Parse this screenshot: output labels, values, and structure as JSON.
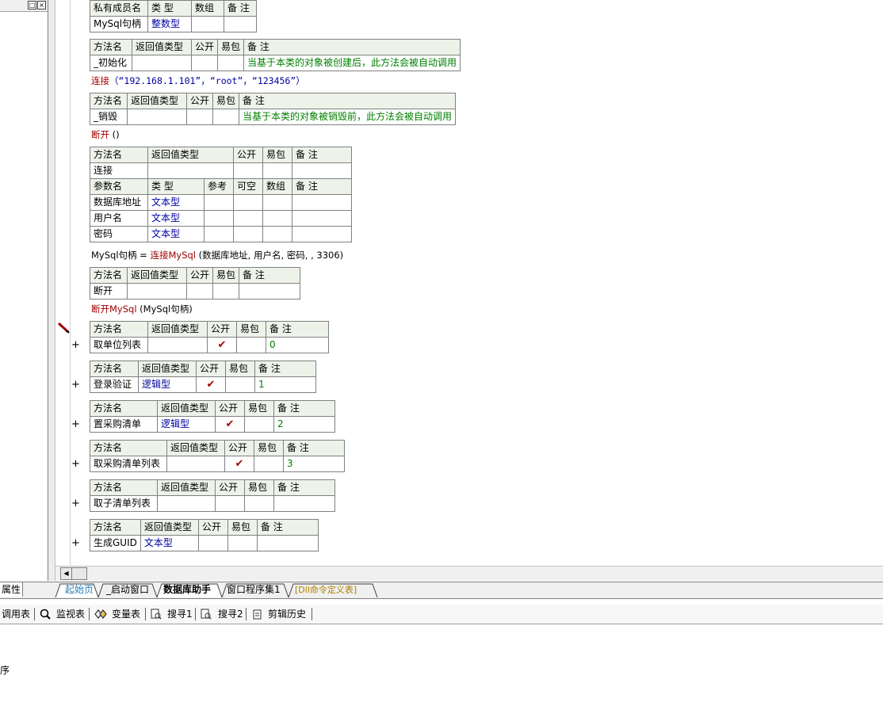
{
  "left_pane": {
    "props_tab": "属性",
    "controls": [
      "□",
      "×"
    ]
  },
  "member_table": {
    "headers": [
      "私有成员名",
      "类 型",
      "数组",
      "备 注"
    ],
    "row": {
      "name": "MySql句柄",
      "type": "整数型"
    }
  },
  "method_header": [
    "方法名",
    "返回值类型",
    "公开",
    "易包",
    "备 注"
  ],
  "param_header": [
    "参数名",
    "类 型",
    "参考",
    "可空",
    "数组",
    "备 注"
  ],
  "init_method": {
    "name": "_初始化",
    "note": "当基于本类的对象被创建后，此方法会被自动调用"
  },
  "init_code": {
    "fn": "连接",
    "args": "（“192.168.1.101”，“root”，“123456”）"
  },
  "destroy_method": {
    "name": "_销毁",
    "note": "当基于本类的对象被销毁前，此方法会被自动调用"
  },
  "destroy_code": {
    "fn": "断开",
    "args": " ()"
  },
  "connect_method": {
    "name": "连接",
    "params": [
      {
        "name": "数据库地址",
        "type": "文本型"
      },
      {
        "name": "用户名",
        "type": "文本型"
      },
      {
        "name": "密码",
        "type": "文本型"
      }
    ]
  },
  "connect_code": {
    "lhs": "MySql句柄",
    "eq": " = ",
    "fn": "连接MySql",
    "args": " (数据库地址, 用户名, 密码, , 3306)"
  },
  "disconnect_method": {
    "name": "断开"
  },
  "disconnect_code": {
    "fn": "断开MySql",
    "args": " (MySql句柄)"
  },
  "methods": [
    {
      "name": "取单位列表",
      "ret": "",
      "public": "✔",
      "note": "0"
    },
    {
      "name": "登录验证",
      "ret": "逻辑型",
      "public": "✔",
      "note": "1"
    },
    {
      "name": "置采购清单",
      "ret": "逻辑型",
      "public": "✔",
      "note": "2"
    },
    {
      "name": "取采购清单列表",
      "ret": "",
      "public": "✔",
      "note": "3"
    },
    {
      "name": "取子清单列表",
      "ret": "",
      "public": "",
      "note": ""
    },
    {
      "name": "生成GUID",
      "ret": "文本型",
      "public": "",
      "note": ""
    }
  ],
  "plus_symbol": "+",
  "tabs": [
    "起始页",
    "_启动窗口",
    "数据库助手",
    "窗口程序集1",
    "[Dll命令定义表]"
  ],
  "toolbar": [
    "调用表",
    "监视表",
    "变量表",
    "搜寻1",
    "搜寻2",
    "剪辑历史"
  ],
  "output_text": "序",
  "colors": {
    "header_bg": "#eef3e9",
    "type_blue": "#0000a0",
    "note_green": "#008000",
    "fn_red": "#a00000"
  }
}
